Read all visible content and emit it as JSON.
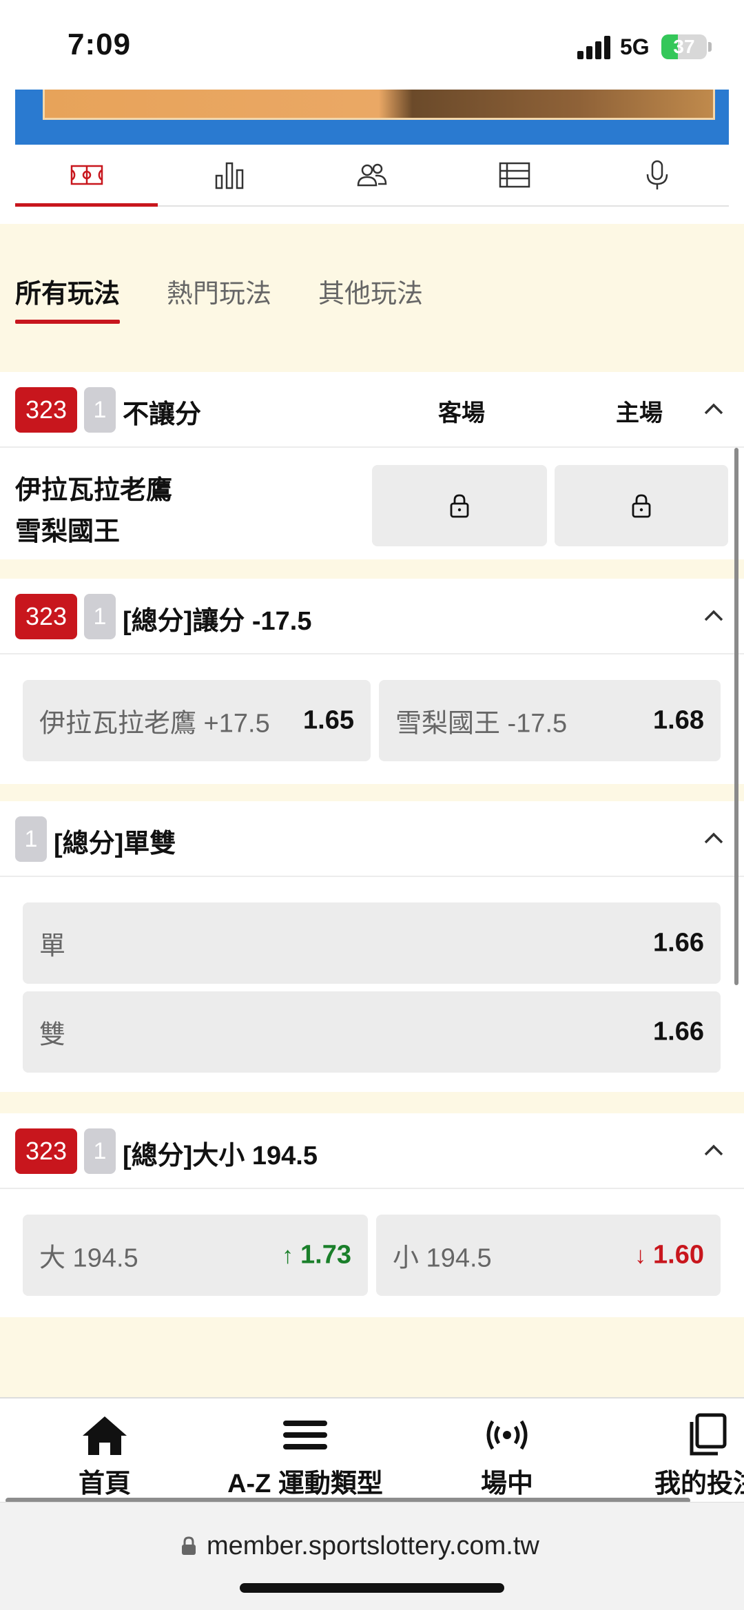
{
  "status_bar": {
    "time": "7:09",
    "network": "5G",
    "battery": "37"
  },
  "icon_tabs": [
    {
      "name": "court-icon",
      "active": true
    },
    {
      "name": "stats-icon",
      "active": false
    },
    {
      "name": "players-icon",
      "active": false
    },
    {
      "name": "list-icon",
      "active": false
    },
    {
      "name": "microphone-icon",
      "active": false
    }
  ],
  "play_tabs": [
    "所有玩法",
    "熱門玩法",
    "其他玩法"
  ],
  "markets": {
    "moneyline": {
      "code": "323",
      "num": "1",
      "title": "不讓分",
      "away_label": "客場",
      "home_label": "主場",
      "team_away": "伊拉瓦拉老鷹",
      "team_home": "雪梨國王"
    },
    "spread": {
      "code": "323",
      "num": "1",
      "title": "[總分]讓分 -17.5",
      "options": [
        {
          "label": "伊拉瓦拉老鷹 +17.5",
          "odds": "1.65"
        },
        {
          "label": "雪梨國王 -17.5",
          "odds": "1.68"
        }
      ]
    },
    "odd_even": {
      "num": "1",
      "title": "[總分]單雙",
      "options": [
        {
          "label": "單",
          "odds": "1.66"
        },
        {
          "label": "雙",
          "odds": "1.66"
        }
      ]
    },
    "total": {
      "code": "323",
      "num": "1",
      "title": "[總分]大小 194.5",
      "options": [
        {
          "label": "大 194.5",
          "arrow": "↑",
          "odds": "1.73",
          "trend": "up"
        },
        {
          "label": "小 194.5",
          "arrow": "↓",
          "odds": "1.60",
          "trend": "down"
        }
      ]
    }
  },
  "bottom_nav": [
    {
      "label": "首頁",
      "icon": "home-icon"
    },
    {
      "label": "A-Z 運動類型",
      "icon": "menu-icon"
    },
    {
      "label": "場中",
      "icon": "live-icon"
    },
    {
      "label": "我的投注",
      "icon": "copy-icon"
    }
  ],
  "url": "member.sportslottery.com.tw",
  "colors": {
    "accent": "#c8161d",
    "cream": "#fdf8e4",
    "up": "#1a7f2a",
    "down": "#c8161d"
  }
}
